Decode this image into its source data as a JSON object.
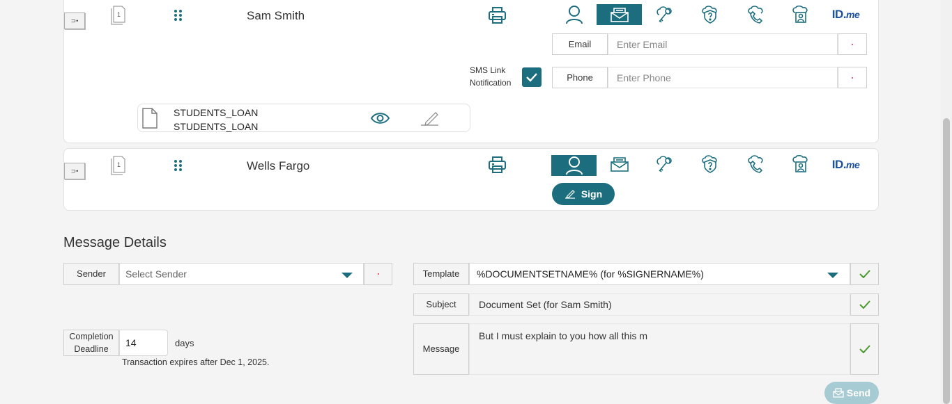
{
  "signers": [
    {
      "name": "Sam Smith",
      "handle_label": "⊃•",
      "doc_count": "1",
      "email_label": "Email",
      "email_placeholder": "Enter Email",
      "phone_label": "Phone",
      "phone_placeholder": "Enter Phone",
      "sms_label_line1": "SMS Link",
      "sms_label_line2": "Notification",
      "sms_checked": true,
      "file_line1": "STUDENTS_LOAN",
      "file_line2": "STUDENTS_LOAN",
      "active_auth": "email"
    },
    {
      "name": "Wells Fargo",
      "handle_label": "⊃•",
      "doc_count": "1",
      "sign_label": "Sign",
      "active_auth": "person"
    }
  ],
  "auth_icons": [
    "person-icon",
    "email-icon",
    "key-icon",
    "security-question-icon",
    "phone-icon",
    "kba-icon",
    "idme-logo"
  ],
  "idme": {
    "main": "ID.",
    "suffix": "me"
  },
  "message": {
    "title": "Message Details",
    "sender_label": "Sender",
    "sender_placeholder": "Select Sender",
    "completion_label_line1": "Completion",
    "completion_label_line2": "Deadline",
    "completion_value": "14",
    "completion_unit": "days",
    "expires_text": "Transaction expires after Dec 1, 2025.",
    "template_label": "Template",
    "template_value": "%DOCUMENTSETNAME% (for %SIGNERNAME%)",
    "subject_label": "Subject",
    "subject_value": "Document Set (for Sam Smith)",
    "message_label": "Message",
    "message_value": "But I must explain to you how all this m",
    "send_label": "Send"
  },
  "colors": {
    "accent": "#1c6e7e",
    "required": "#e0344a",
    "ok": "#4a9a2e",
    "idme": "#1b4fa0"
  }
}
